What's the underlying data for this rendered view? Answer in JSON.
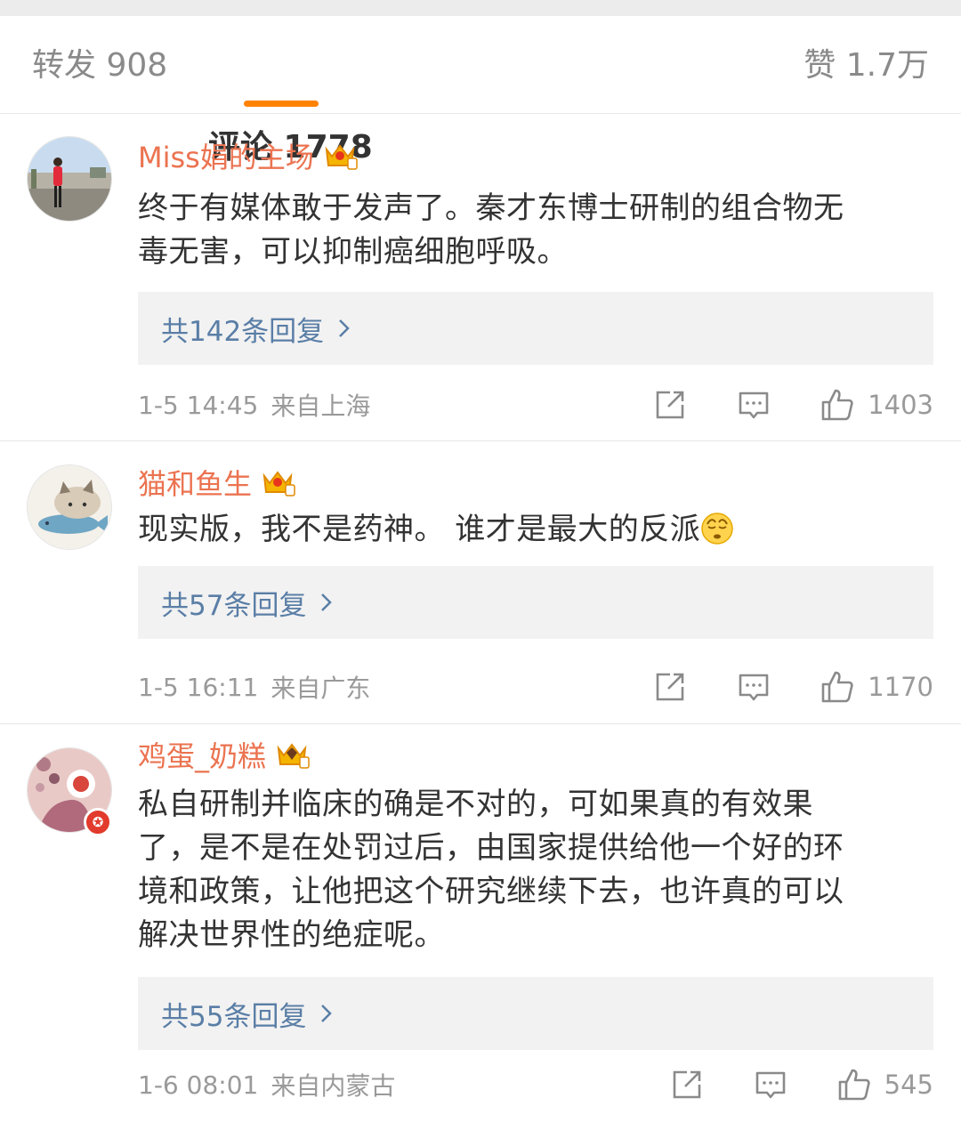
{
  "tabs": {
    "repost": "转发 908",
    "comments": "评论 1778",
    "likes": "赞 1.7万"
  },
  "colors": {
    "accent": "#ff8200",
    "username": "#eb7350",
    "reply_link": "#5a7ea6",
    "meta": "#9a9a9a"
  },
  "comments": [
    {
      "username": "Miss娟的主场",
      "text_lines": [
        "终于有媒体敢于发声了。秦才东博士研制的组合物无",
        "毒无害，可以抑制癌细胞呼吸。"
      ],
      "replies": "共142条回复",
      "time": "1-5 14:45",
      "source": "来自上海",
      "likes": "1403",
      "badge_icon": "crown-icon"
    },
    {
      "username": "猫和鱼生",
      "text_lines": [
        "现实版，我不是药神。 谁才是最大的反派"
      ],
      "emoji": "flushed-face-emoji",
      "replies": "共57条回复",
      "time": "1-5 16:11",
      "source": "来自广东",
      "likes": "1170",
      "badge_icon": "crown-icon"
    },
    {
      "username": "鸡蛋_奶糕",
      "text_lines": [
        "私自研制并临床的确是不对的，可如果真的有效果",
        "了，是不是在处罚过后，由国家提供给他一个好的环",
        "境和政策，让他把这个研究继续下去，也许真的可以",
        "解决世界性的绝症呢。"
      ],
      "replies": "共55条回复",
      "time": "1-6 08:01",
      "source": "来自内蒙古",
      "likes": "545",
      "badge_icon": "crown-icon",
      "avatar_badge": "✪"
    }
  ]
}
